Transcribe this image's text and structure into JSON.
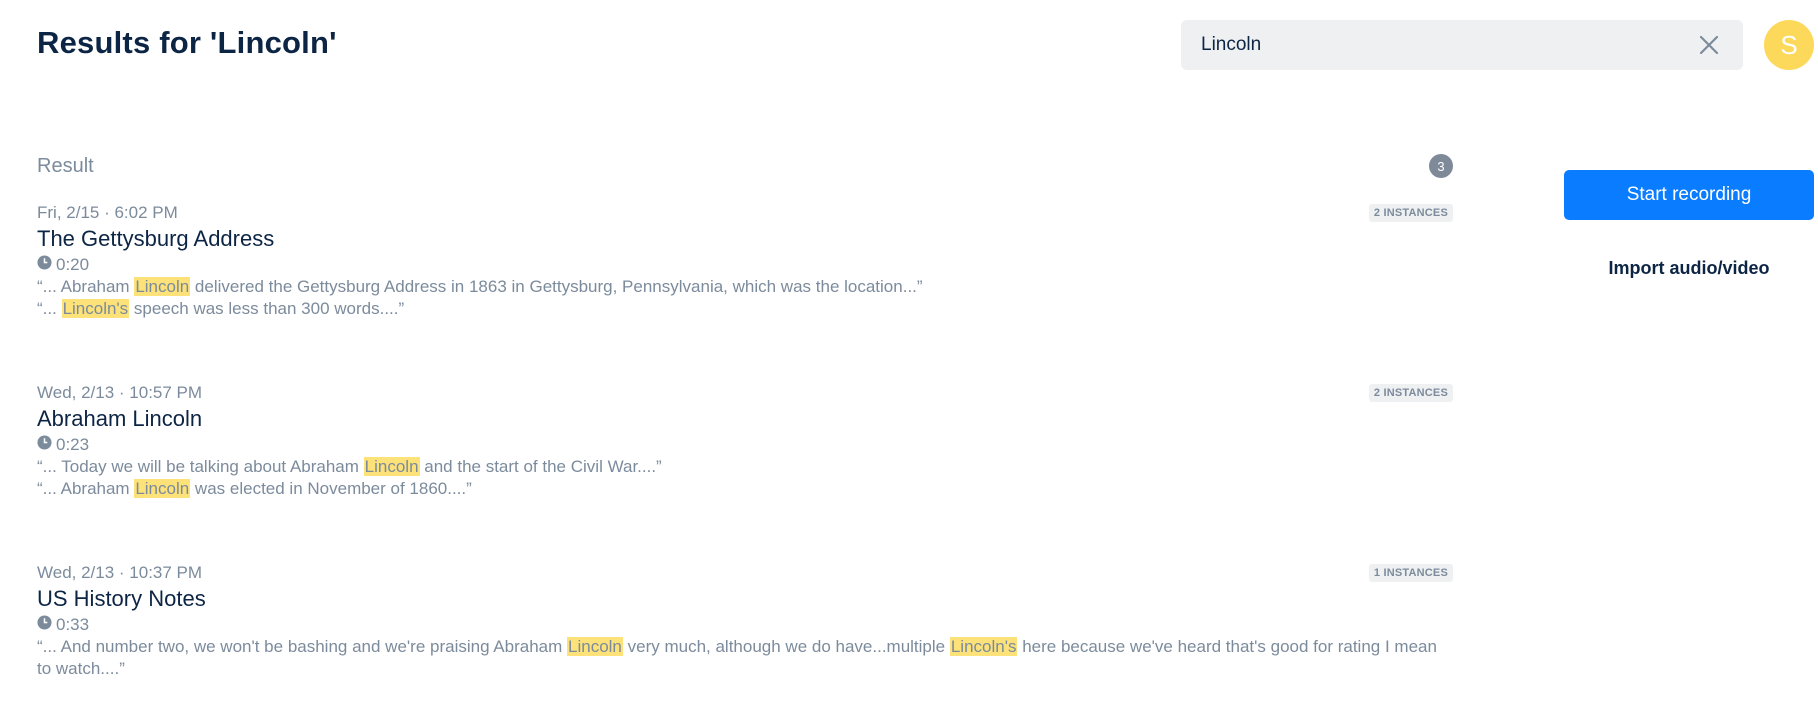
{
  "header": {
    "title": "Results for 'Lincoln'",
    "search_value": "Lincoln",
    "avatar_initial": "S"
  },
  "results": {
    "label": "Result",
    "count": "3",
    "items": [
      {
        "date": "Fri, 2/15 · 6:02 PM",
        "title": "The Gettysburg Address",
        "duration": "0:20",
        "instances": "2 INSTANCES",
        "snippets": [
          [
            {
              "t": "“... Abraham "
            },
            {
              "t": "Lincoln",
              "hl": true
            },
            {
              "t": " delivered the Gettysburg Address in 1863 in Gettysburg, Pennsylvania, which was the location...”"
            }
          ],
          [
            {
              "t": "“... "
            },
            {
              "t": "Lincoln's",
              "hl": true
            },
            {
              "t": " speech was less than 300 words....”"
            }
          ]
        ]
      },
      {
        "date": "Wed, 2/13 · 10:57 PM",
        "title": "Abraham Lincoln",
        "duration": "0:23",
        "instances": "2 INSTANCES",
        "snippets": [
          [
            {
              "t": "“... Today we will be talking about Abraham "
            },
            {
              "t": "Lincoln",
              "hl": true
            },
            {
              "t": " and the start of the Civil War....”"
            }
          ],
          [
            {
              "t": "“... Abraham "
            },
            {
              "t": "Lincoln",
              "hl": true
            },
            {
              "t": " was elected in November of 1860....”"
            }
          ]
        ]
      },
      {
        "date": "Wed, 2/13 · 10:37 PM",
        "title": "US History Notes",
        "duration": "0:33",
        "instances": "1 INSTANCES",
        "snippets": [
          [
            {
              "t": "“... And number two, we won't be bashing and we're praising Abraham "
            },
            {
              "t": "Lincoln",
              "hl": true
            },
            {
              "t": " very much, although we do have...multiple "
            },
            {
              "t": "Lincoln's",
              "hl": true
            },
            {
              "t": " here because we've heard that's good for rating I mean to watch....”"
            }
          ]
        ]
      }
    ]
  },
  "actions": {
    "start_recording": "Start recording",
    "import": "Import audio/video"
  },
  "colors": {
    "accent": "#0a7cff",
    "highlight": "#fde27a",
    "avatar": "#fcd95a",
    "title_text": "#0d2545",
    "muted_text": "#7c8b9c"
  },
  "icons": {
    "clear": "close-icon",
    "duration": "clock-icon"
  }
}
